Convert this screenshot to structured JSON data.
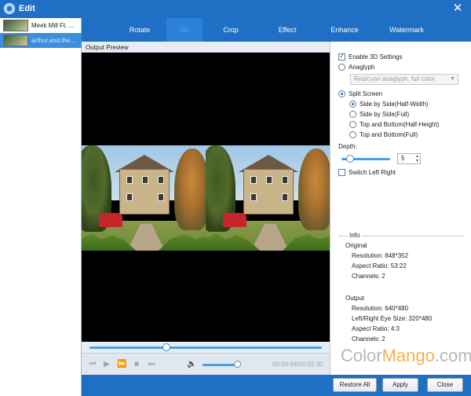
{
  "window": {
    "title": "Edit"
  },
  "files": [
    {
      "label": "Meek Mill Ft. ..."
    },
    {
      "label": "arthur.and.the..."
    }
  ],
  "tabs": [
    {
      "label": "Rotate"
    },
    {
      "label": "3D"
    },
    {
      "label": "Crop"
    },
    {
      "label": "Effect"
    },
    {
      "label": "Enhance"
    },
    {
      "label": "Watermark"
    }
  ],
  "preview": {
    "title": "Output Preview"
  },
  "playback": {
    "time": "00:00:44/00:02:30",
    "seek_fraction": 0.33,
    "volume_fraction": 0.92
  },
  "settings": {
    "enable_3d": "Enable 3D Settings",
    "anaglyph": "Anaglyph",
    "anaglyph_select": "Red/cyan anaglyph, full color",
    "split_screen": "Split Screen",
    "sbs_half": "Side by Side(Half-Width)",
    "sbs_full": "Side by Side(Full)",
    "tb_half": "Top and Bottom(Half-Height)",
    "tb_full": "Top and Bottom(Full)",
    "depth_label": "Depth:",
    "depth_value": "5",
    "switch_lr": "Switch Left Right"
  },
  "info": {
    "legend": "Info",
    "original_label": "Original",
    "original": {
      "resolution": "Resolution: 848*352",
      "aspect": "Aspect Ratio: 53:22",
      "channels": "Channels: 2"
    },
    "output_label": "Output",
    "output": {
      "resolution": "Resolution: 640*480",
      "eye_size": "Left/Right Eye Size: 320*480",
      "aspect": "Aspect Ratio: 4:3",
      "channels": "Channels: 2"
    }
  },
  "buttons": {
    "restore": "Restore All",
    "apply": "Apply",
    "close": "Close"
  },
  "watermark": {
    "part1": "Color",
    "part2": "Mango",
    "part3": ".com"
  }
}
